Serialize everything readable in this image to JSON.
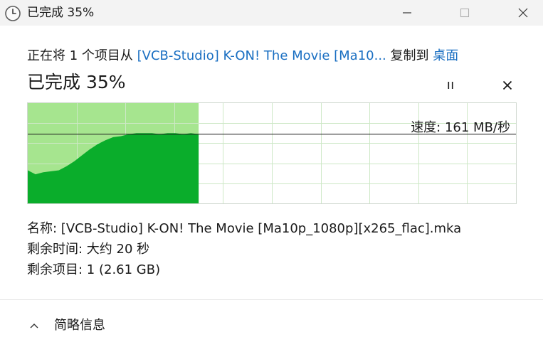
{
  "window": {
    "title": "已完成 35%",
    "icon": "clock-icon",
    "controls": [
      "minimize-icon",
      "maximize-icon",
      "close-icon"
    ]
  },
  "copy": {
    "prefix": "正在将 1 个项目从 ",
    "source": "[VCB-Studio] K-ON! The Movie [Ma10...",
    "middle": " 复制到 ",
    "destination": "桌面"
  },
  "progress": {
    "heading": "已完成 35%",
    "percent": 35,
    "pause_icon": "pause-icon",
    "cancel_icon": "close-icon"
  },
  "graph": {
    "speed_text": "速度: 161 MB/秒",
    "fill_color": "#0aad2b",
    "progress_color": "#a6e58f",
    "grid_color": "#cde8c6",
    "speed_series": [
      0.33,
      0.29,
      0.31,
      0.32,
      0.33,
      0.37,
      0.42,
      0.48,
      0.54,
      0.59,
      0.63,
      0.66,
      0.67,
      0.69,
      0.7,
      0.7,
      0.7,
      0.69,
      0.7,
      0.7,
      0.69,
      0.7,
      0.69
    ]
  },
  "details": {
    "name_label": "名称: ",
    "name_value": "[VCB-Studio] K-ON! The Movie [Ma10p_1080p][x265_flac].mka",
    "time_label": "剩余时间: ",
    "time_value": "大约 20 秒",
    "items_label": "剩余项目: ",
    "items_value": "1 (2.61 GB)"
  },
  "footer": {
    "toggle_label": "简略信息",
    "toggle_icon": "chevron-up-icon"
  }
}
